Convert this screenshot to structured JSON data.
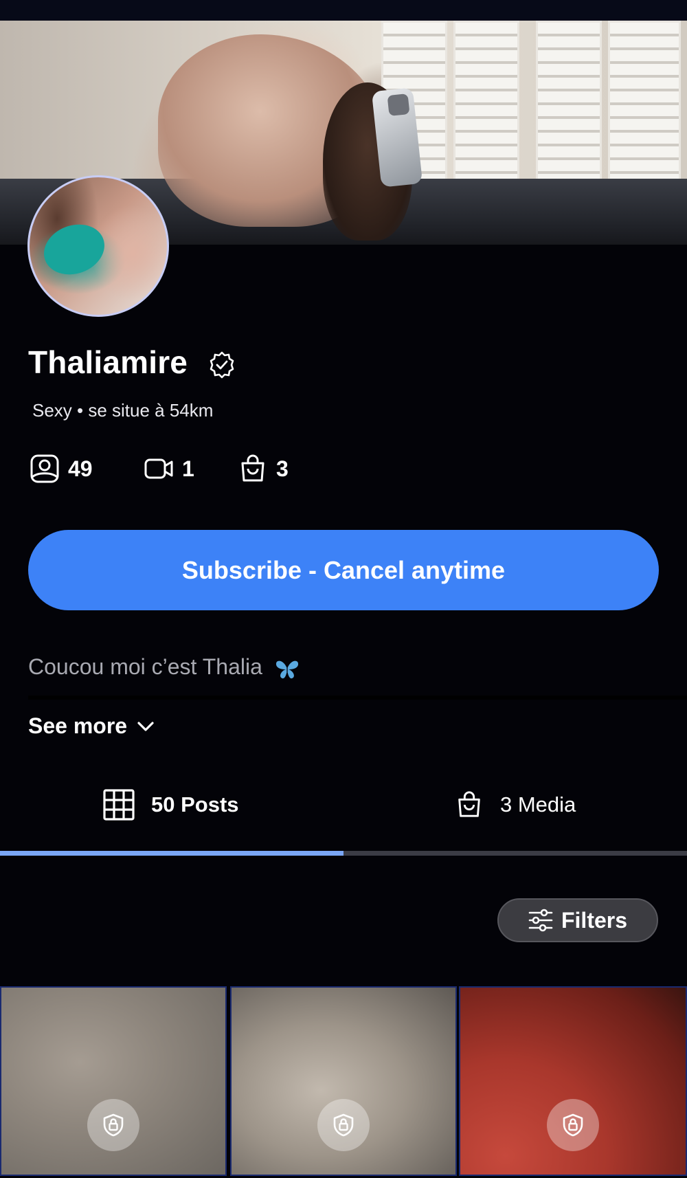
{
  "profile": {
    "name": "Thaliamire",
    "tagline": "Sexy • se situe à 54km",
    "stats": {
      "photos": "49",
      "videos": "1",
      "media": "3"
    },
    "bio": "Coucou moi c’est Thalia",
    "see_more": "See more"
  },
  "actions": {
    "subscribe_label": "Subscribe - Cancel anytime"
  },
  "tabs": {
    "posts_label": "50 Posts",
    "media_label": "3 Media",
    "active": "posts",
    "progress_fraction": 0.5
  },
  "filters": {
    "label": "Filters"
  },
  "colors": {
    "accent": "#3d82f7",
    "background": "#030308",
    "tab_indicator": "#7aa6f5"
  },
  "icons": [
    "verified-badge-icon",
    "photo-icon",
    "video-icon",
    "bag-icon",
    "butterfly-emoji-icon",
    "chevron-down-icon",
    "grid-icon",
    "sliders-icon",
    "lock-icon"
  ]
}
